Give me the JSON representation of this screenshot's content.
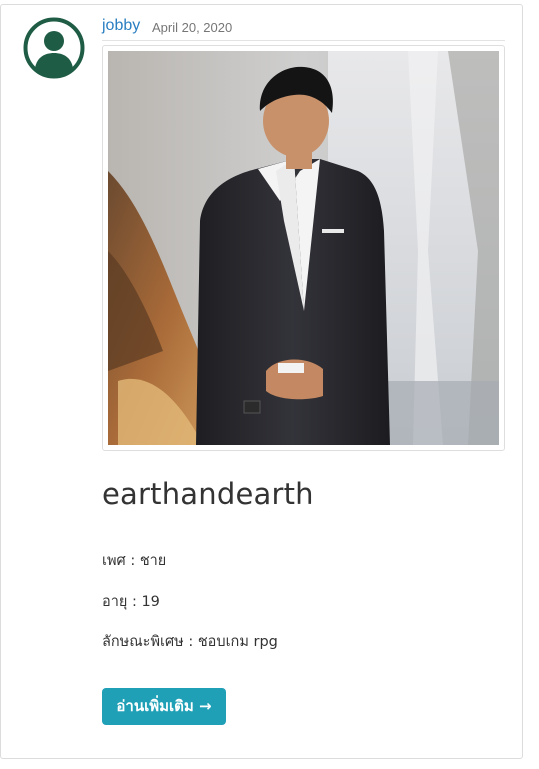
{
  "post": {
    "author": "jobby",
    "date": "April 20, 2020",
    "title": "earthandearth",
    "fields": [
      "เพศ : ชาย",
      "อายุ : 19",
      "ลักษณะพิเศษ : ชอบเกม rpg"
    ],
    "read_more_label": "อ่านเพิ่มเติม →"
  },
  "colors": {
    "avatar": "#1f5c45",
    "author_link": "#2a7fc2",
    "button": "#1fa0b6"
  },
  "icons": {
    "avatar": "user-avatar-icon"
  }
}
